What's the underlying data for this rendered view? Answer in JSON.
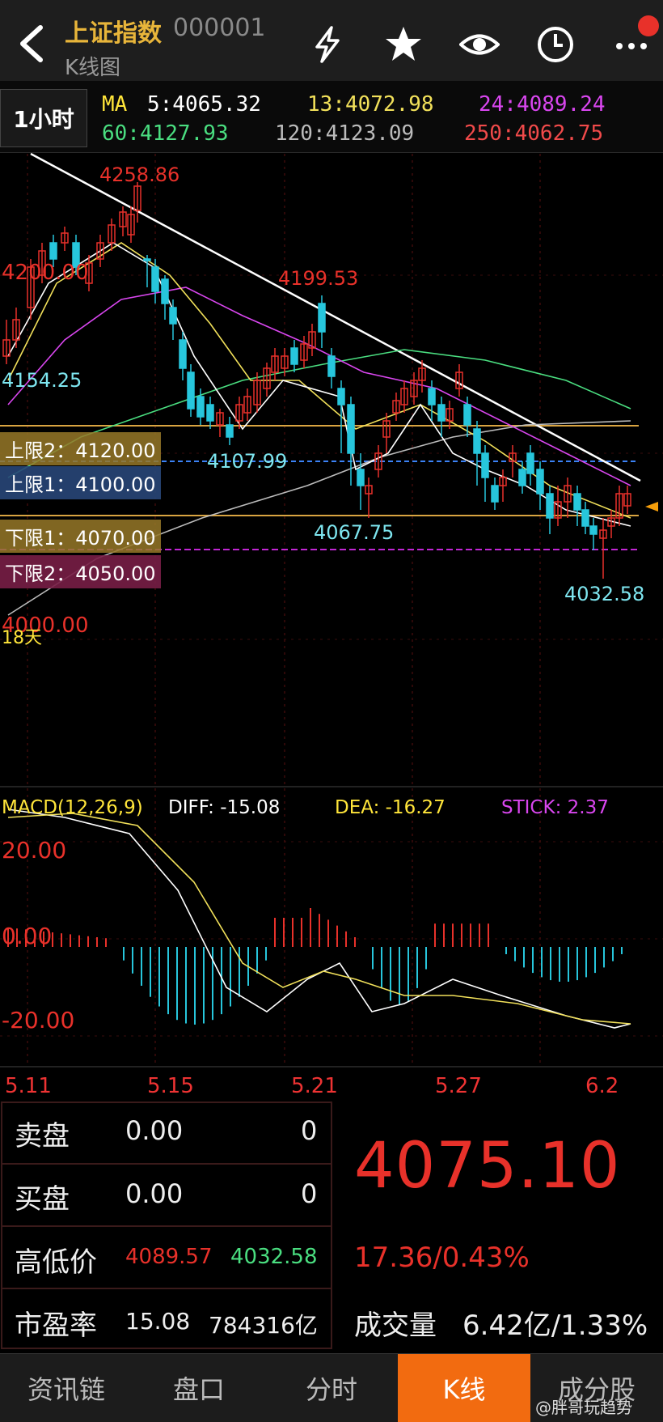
{
  "header": {
    "title": "上证指数",
    "code": "000001",
    "subtitle": "K线图",
    "icons": [
      "back-arrow-icon",
      "flash-icon",
      "star-icon",
      "eye-icon",
      "clock-icon",
      "more-icon"
    ]
  },
  "ma_bar": {
    "period": "1小时",
    "ma_prefix": "MA",
    "ma5": "5:4065.32",
    "ma13": "13:4072.98",
    "ma24": "24:4089.24",
    "ma60": "60:4127.93",
    "ma120": "120:4123.09",
    "ma250": "250:4062.75"
  },
  "price_chart": {
    "high_label": "4258.86",
    "label_4199": "4199.53",
    "label_4200": "4200.00",
    "label_4154": "4154.25",
    "label_4107": "4107.99",
    "label_4067": "4067.75",
    "low_label": "4032.58",
    "label_4000": "4000.00",
    "days_label": "18天",
    "zones": {
      "upper2": "上限2：4120.00",
      "upper1": "上限1：4100.00",
      "lower1": "下限1：4070.00",
      "lower2": "下限2：4050.00"
    }
  },
  "macd": {
    "title": "MACD(12,26,9)",
    "diff": "DIFF: -15.08",
    "dea": "DEA: -16.27",
    "stick": "STICK: 2.37",
    "y_top": "20.00",
    "y_mid": "0.00",
    "y_bottom": "-20.00"
  },
  "dates": [
    "5.11",
    "5.15",
    "5.21",
    "5.27",
    "6.2"
  ],
  "quote": {
    "sell_label": "卖盘",
    "sell_price": "0.00",
    "sell_qty": "0",
    "buy_label": "买盘",
    "buy_price": "0.00",
    "buy_qty": "0",
    "hl_label": "高低价",
    "high": "4089.57",
    "low": "4032.58",
    "pe_label": "市盈率",
    "pe": "15.08",
    "mcap": "784316亿",
    "last_price": "4075.10",
    "change": "17.36/0.43%",
    "volume_label": "成交量",
    "volume": "6.42亿/1.33%"
  },
  "nav": {
    "tabs": [
      "资讯链",
      "盘口",
      "分时",
      "K线",
      "成分股"
    ],
    "active": "K线"
  },
  "watermark": "@胖哥玩趋势",
  "colors": {
    "up": "#e8312a",
    "down": "#27c6dc",
    "accent": "#f26b10",
    "title": "#e8b53a"
  }
}
